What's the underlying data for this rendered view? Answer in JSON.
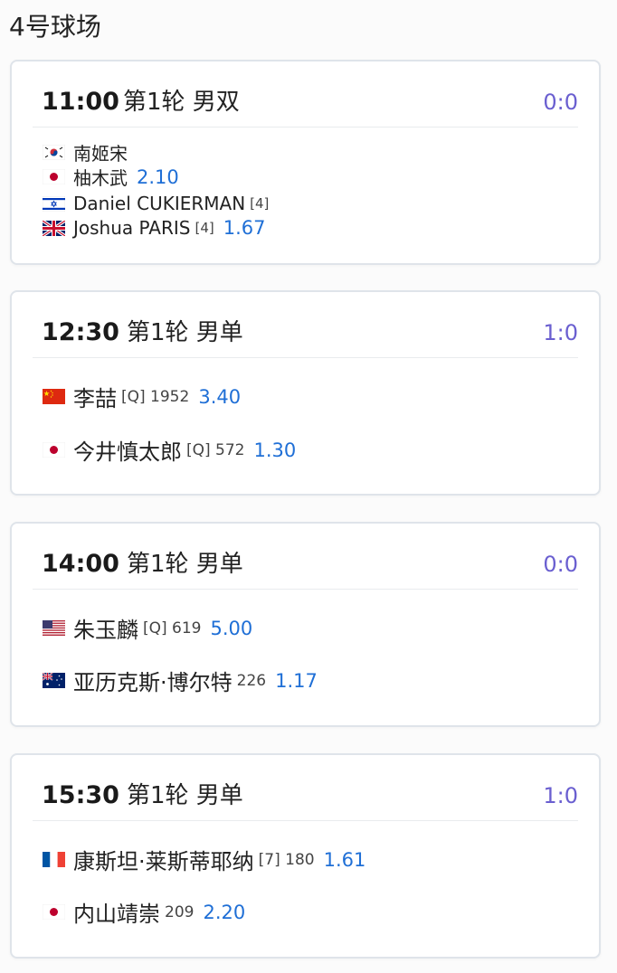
{
  "court": {
    "title": "4号球场"
  },
  "matches": [
    {
      "time": "11:00",
      "round": "第1轮 男双",
      "score": "0:0",
      "players": [
        {
          "flag": "kr-flag-icon",
          "name": "南姬宋",
          "meta": "",
          "odds": ""
        },
        {
          "flag": "jp-flag-icon",
          "name": "柚木武",
          "meta": "",
          "odds": "2.10"
        },
        {
          "flag": "il-flag-icon",
          "name": "Daniel CUKIERMAN",
          "meta": "[4]",
          "odds": ""
        },
        {
          "flag": "gb-flag-icon",
          "name": "Joshua PARIS",
          "meta": "[4]",
          "odds": "1.67"
        }
      ]
    },
    {
      "time": "12:30",
      "round": "第1轮 男单",
      "score": "1:0",
      "players": [
        {
          "flag": "cn-flag-icon",
          "name": "李喆",
          "meta": "[Q] 1952",
          "odds": "3.40"
        },
        {
          "flag": "jp-flag-icon",
          "name": "今井慎太郎",
          "meta": "[Q] 572",
          "odds": "1.30"
        }
      ]
    },
    {
      "time": "14:00",
      "round": "第1轮 男单",
      "score": "0:0",
      "players": [
        {
          "flag": "us-flag-icon",
          "name": "朱玉麟",
          "meta": "[Q] 619",
          "odds": "5.00"
        },
        {
          "flag": "au-flag-icon",
          "name": "亚历克斯·博尔特",
          "meta": "226",
          "odds": "1.17"
        }
      ]
    },
    {
      "time": "15:30",
      "round": "第1轮 男单",
      "score": "1:0",
      "players": [
        {
          "flag": "fr-flag-icon",
          "name": "康斯坦·莱斯蒂耶纳",
          "meta": "[7] 180",
          "odds": "1.61"
        },
        {
          "flag": "jp-flag-icon",
          "name": "内山靖崇",
          "meta": "209",
          "odds": "2.20"
        }
      ]
    }
  ]
}
